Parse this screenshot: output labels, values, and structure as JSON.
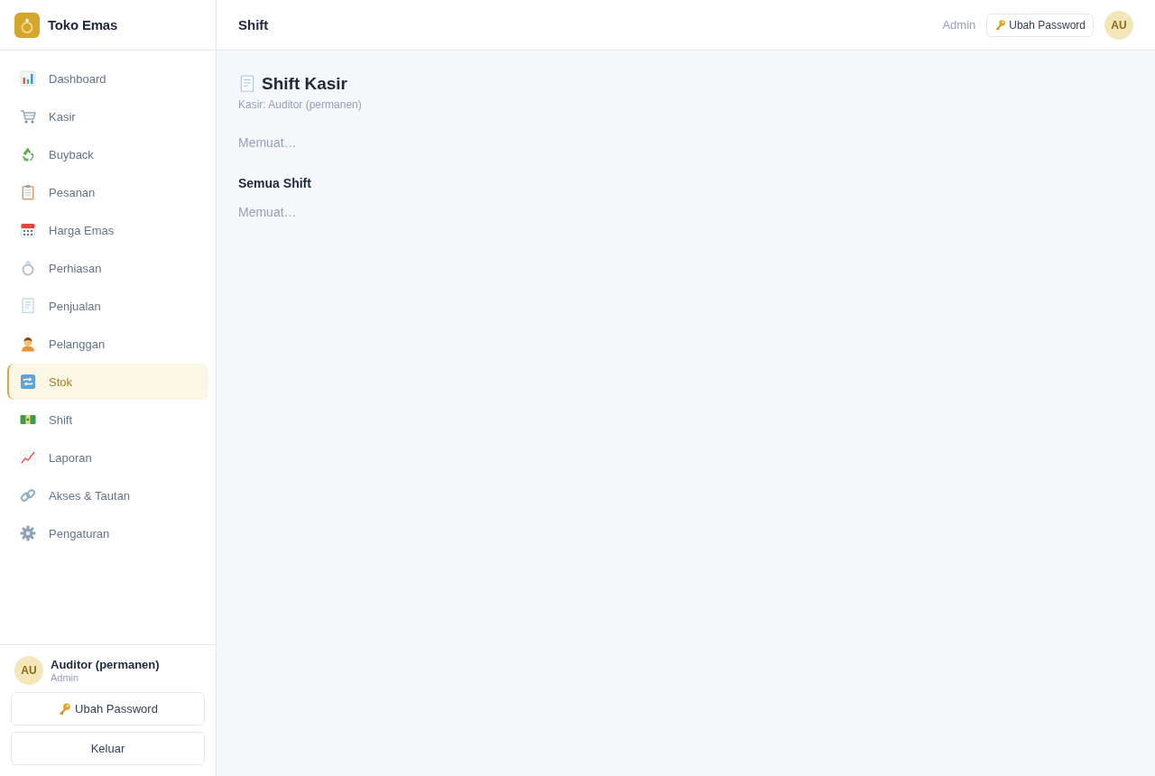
{
  "sidebar": {
    "brand": "Toko Emas",
    "items": [
      {
        "label": "Dashboard",
        "selected": false
      },
      {
        "label": "Kasir",
        "selected": false
      },
      {
        "label": "Buyback",
        "selected": false
      },
      {
        "label": "Pesanan",
        "selected": false
      },
      {
        "label": "Harga Emas",
        "selected": false
      },
      {
        "label": "Perhiasan",
        "selected": false
      },
      {
        "label": "Penjualan",
        "selected": false
      },
      {
        "label": "Pelanggan",
        "selected": false
      },
      {
        "label": "Stok",
        "selected": true
      },
      {
        "label": "Shift",
        "selected": false
      },
      {
        "label": "Laporan",
        "selected": false
      },
      {
        "label": "Akses & Tautan",
        "selected": false
      },
      {
        "label": "Pengaturan",
        "selected": false
      }
    ],
    "user": {
      "initials": "AU",
      "name": "Auditor (permanen)",
      "role": "Admin"
    },
    "buttons": [
      {
        "label": "Ubah Password",
        "kind": "password"
      },
      {
        "label": "Keluar",
        "kind": "logout"
      }
    ]
  },
  "header": {
    "title": "Shift",
    "role": "Admin",
    "button": "Ubah Password",
    "avatar": "AU"
  },
  "content": {
    "title": "Shift Kasir",
    "subtitle": "Kasir: Auditor (permanen)",
    "status": "Memuat…",
    "sections": [
      {
        "title": "Semua Shift",
        "status": "Memuat…"
      }
    ]
  }
}
